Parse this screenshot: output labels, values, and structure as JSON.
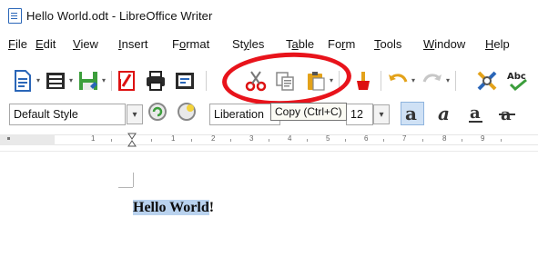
{
  "window": {
    "title": "Hello World.odt - LibreOffice Writer"
  },
  "menu": {
    "items": [
      {
        "label": "File",
        "underline": "F",
        "rest": "ile"
      },
      {
        "label": "Edit",
        "underline": "E",
        "rest": "dit"
      },
      {
        "label": "View",
        "underline": "V",
        "rest": "iew"
      },
      {
        "label": "Insert",
        "underline": "I",
        "rest": "nsert"
      },
      {
        "label": "Format",
        "pre": "F",
        "underline": "o",
        "rest": "rmat"
      },
      {
        "label": "Styles",
        "pre": "St",
        "underline": "y",
        "rest": "les"
      },
      {
        "label": "Table",
        "pre": "T",
        "underline": "a",
        "rest": "ble"
      },
      {
        "label": "Form",
        "pre": "Fo",
        "underline": "r",
        "rest": "m"
      },
      {
        "label": "Tools",
        "underline": "T",
        "rest": "ools"
      },
      {
        "label": "Window",
        "underline": "W",
        "rest": "indow"
      },
      {
        "label": "Help",
        "underline": "H",
        "rest": "elp"
      }
    ]
  },
  "toolbar1": {
    "buttons": [
      "new-document-icon",
      "open-icon",
      "save-icon",
      "export-pdf-icon",
      "print-icon",
      "print-preview-icon",
      "cut-icon",
      "copy-icon",
      "paste-icon",
      "clone-formatting-icon",
      "undo-icon",
      "redo-icon",
      "find-replace-icon",
      "spelling-icon"
    ]
  },
  "toolbar2": {
    "paragraph_style": "Default Style",
    "font_name": "Liberation",
    "font_size": "12",
    "tooltip": "Copy (Ctrl+C)"
  },
  "ruler": {
    "numbers": [
      "1",
      "1",
      "2",
      "3",
      "4",
      "5",
      "6",
      "7",
      "8",
      "9"
    ]
  },
  "document": {
    "selected_text": "Hello World",
    "trailing_text": "!"
  },
  "colors": {
    "highlight_ring": "#e8131b",
    "selection": "#b9d2ee",
    "accent_blue": "#2a66b8"
  }
}
